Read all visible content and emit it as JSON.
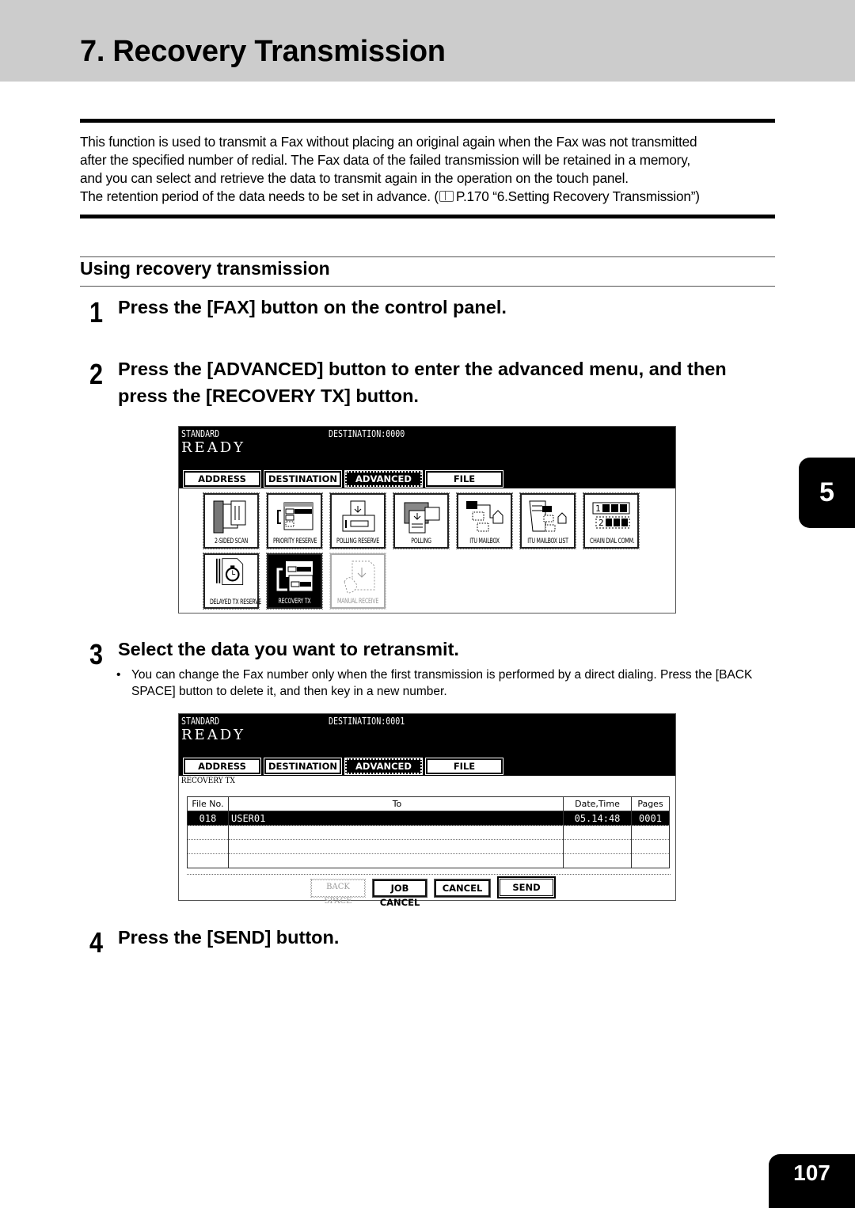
{
  "page": {
    "title": "7. Recovery Transmission",
    "chapter_tab": "5",
    "page_number": "107"
  },
  "intro": {
    "lines": [
      "This function is used to transmit a Fax without placing an original again when the Fax was not transmitted",
      "after the specified number of redial. The Fax data of the failed transmission will be retained in a memory,",
      "and you can select and retrieve the data to transmit again in the operation on the touch panel."
    ],
    "retention_prefix": "The retention period of the data needs to be set in advance. (",
    "reference_icon": "book-reference-icon",
    "retention_ref": "P.170 “6.Setting Recovery Transmission”)"
  },
  "section": {
    "heading": "Using recovery transmission"
  },
  "steps": [
    {
      "number": "1",
      "text": "Press the [FAX] button on the control panel."
    },
    {
      "number": "2",
      "text_line1": "Press the [ADVANCED] button to enter the advanced menu, and then",
      "text_line2": "press the [RECOVERY TX] button."
    },
    {
      "number": "3",
      "text": "Select the data you want to retransmit.",
      "note": "You can change the Fax number only when the first transmission is performed by a direct dialing. Press the [BACK SPACE] button to delete it, and then key in a new number."
    },
    {
      "number": "4",
      "text": "Press the [SEND] button."
    }
  ],
  "panel1": {
    "mode": "STANDARD",
    "destination": "DESTINATION:0000",
    "status": "READY",
    "tabs": [
      "ADDRESS",
      "DESTINATION",
      "ADVANCED",
      "FILE"
    ],
    "active_tab": "ADVANCED",
    "functions": [
      {
        "label": "2-SIDED SCAN",
        "icon": "two-sided-scan-icon"
      },
      {
        "label": "PRIORITY RESERVE",
        "icon": "priority-reserve-icon"
      },
      {
        "label": "POLLING RESERVE",
        "icon": "polling-reserve-icon"
      },
      {
        "label": "POLLING",
        "icon": "polling-icon"
      },
      {
        "label": "ITU MAILBOX",
        "icon": "itu-mailbox-icon"
      },
      {
        "label": "ITU MAILBOX LIST",
        "icon": "itu-mailbox-list-icon"
      },
      {
        "label": "CHAIN DIAL COMM.",
        "icon": "chain-dial-icon"
      },
      {
        "label": "DELAYED TX RESERVE",
        "icon": "delayed-tx-icon"
      },
      {
        "label": "RECOVERY TX",
        "icon": "recovery-tx-icon",
        "state": "selected"
      },
      {
        "label": "MANUAL RECEIVE",
        "icon": "manual-receive-icon",
        "state": "disabled"
      }
    ]
  },
  "panel2": {
    "mode": "STANDARD",
    "destination": "DESTINATION:0001",
    "status": "READY",
    "tabs": [
      "ADDRESS",
      "DESTINATION",
      "ADVANCED",
      "FILE"
    ],
    "active_tab": "ADVANCED",
    "screen_label": "RECOVERY TX",
    "columns": [
      "File No.",
      "To",
      "Date,Time",
      "Pages"
    ],
    "rows": [
      {
        "file_no": "018",
        "to": "USER01",
        "date_time": "05.14:48",
        "pages": "0001",
        "selected": true
      },
      {
        "file_no": "",
        "to": "",
        "date_time": "",
        "pages": ""
      },
      {
        "file_no": "",
        "to": "",
        "date_time": "",
        "pages": ""
      },
      {
        "file_no": "",
        "to": "",
        "date_time": "",
        "pages": ""
      }
    ],
    "buttons": {
      "back_space": "BACK SPACE",
      "job_cancel": "JOB CANCEL",
      "cancel": "CANCEL",
      "send": "SEND"
    }
  }
}
